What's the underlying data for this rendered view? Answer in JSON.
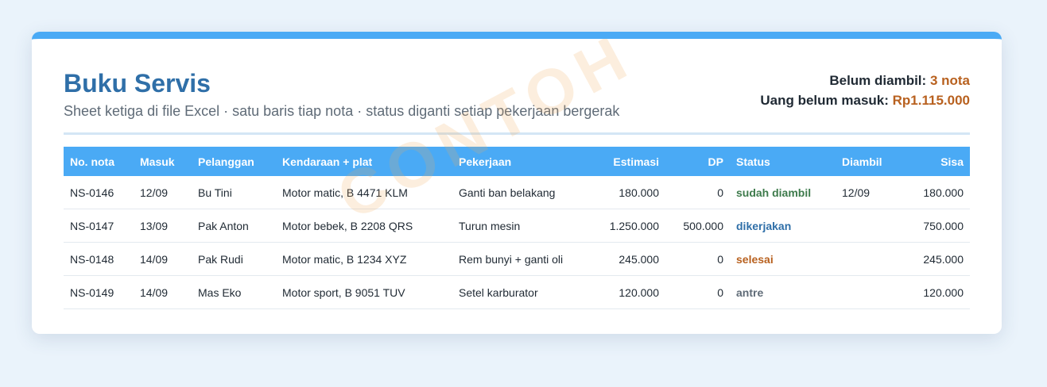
{
  "page": {
    "title": "Buku Servis",
    "subtitle": "Sheet ketiga di file Excel · satu baris tiap nota · status diganti setiap pekerjaan bergerak",
    "watermark": "CONTOH"
  },
  "summary": {
    "belum_diambil_label": "Belum diambil:",
    "belum_diambil_value": "3 nota",
    "uang_label": "Uang belum masuk:",
    "uang_value": "Rp1.115.000"
  },
  "table": {
    "headers": [
      "No. nota",
      "Masuk",
      "Pelanggan",
      "Kendaraan + plat",
      "Pekerjaan",
      "Estimasi",
      "DP",
      "Status",
      "Diambil",
      "Sisa"
    ],
    "rows": [
      {
        "nota": "NS-0146",
        "masuk": "12/09",
        "pelanggan": "Bu Tini",
        "kendaraan": "Motor matic, B 4471 KLM",
        "pekerjaan": "Ganti ban belakang",
        "estimasi": "180.000",
        "dp": "0",
        "status": "sudah diambil",
        "diambil": "12/09",
        "sisa": "180.000"
      },
      {
        "nota": "NS-0147",
        "masuk": "13/09",
        "pelanggan": "Pak Anton",
        "kendaraan": "Motor bebek, B 2208 QRS",
        "pekerjaan": "Turun mesin",
        "estimasi": "1.250.000",
        "dp": "500.000",
        "status": "dikerjakan",
        "diambil": "",
        "sisa": "750.000"
      },
      {
        "nota": "NS-0148",
        "masuk": "14/09",
        "pelanggan": "Pak Rudi",
        "kendaraan": "Motor matic, B 1234 XYZ",
        "pekerjaan": "Rem bunyi + ganti oli",
        "estimasi": "245.000",
        "dp": "0",
        "status": "selesai",
        "diambil": "",
        "sisa": "245.000"
      },
      {
        "nota": "NS-0149",
        "masuk": "14/09",
        "pelanggan": "Mas Eko",
        "kendaraan": "Motor sport, B 9051 TUV",
        "pekerjaan": "Setel karburator",
        "estimasi": "120.000",
        "dp": "0",
        "status": "antre",
        "diambil": "",
        "sisa": "120.000"
      }
    ]
  },
  "colors": {
    "accent": "#4aaaf5",
    "title": "#2f6fa8",
    "highlight": "#b8611f",
    "status_sudah_diambil": "#3e7b4c",
    "status_dikerjakan": "#2f6fa8",
    "status_selesai": "#b8611f",
    "status_antre": "#5f6b77"
  }
}
